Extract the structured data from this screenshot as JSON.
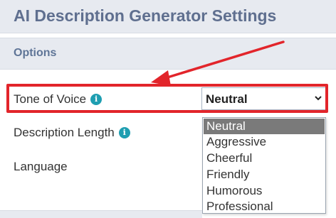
{
  "header": {
    "title": "AI Description Generator Settings"
  },
  "section": {
    "title": "Options"
  },
  "fields": {
    "tone": {
      "label": "Tone of Voice",
      "info_icon": "info-icon",
      "selected": "Neutral"
    },
    "length": {
      "label": "Description Length",
      "info_icon": "info-icon"
    },
    "language": {
      "label": "Language"
    }
  },
  "dropdown": {
    "options": [
      "Neutral",
      "Aggressive",
      "Cheerful",
      "Friendly",
      "Humorous",
      "Professional"
    ],
    "highlighted_index": 0
  },
  "colors": {
    "accent_red": "#e2252b",
    "info_teal": "#1e9eb1",
    "header_bg": "#e7eaf0",
    "title_text": "#5f6f8f"
  },
  "icons": {
    "info": "info-icon",
    "select_arrow": "chevron-down-icon",
    "annotation": "red-arrow-annotation"
  }
}
